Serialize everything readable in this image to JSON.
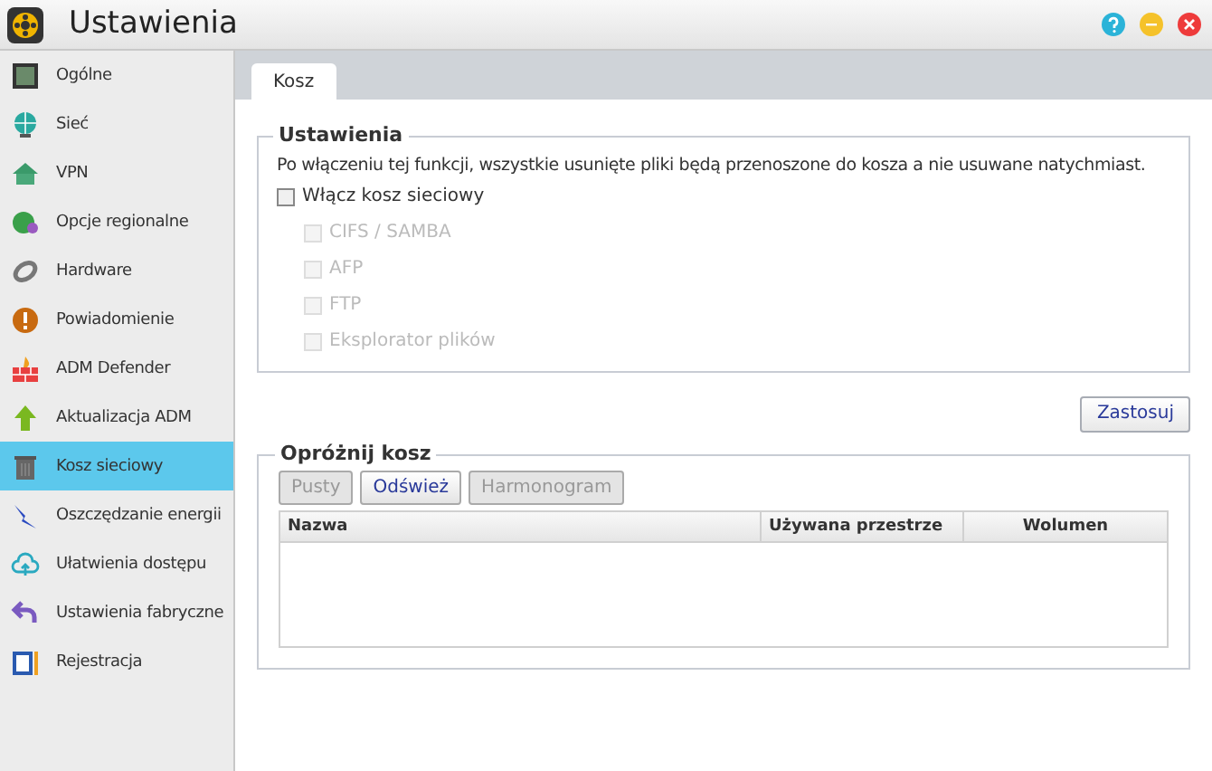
{
  "window": {
    "title": "Ustawienia"
  },
  "sidebar": {
    "items": [
      {
        "label": "Ogólne",
        "selected": false
      },
      {
        "label": "Sieć",
        "selected": false
      },
      {
        "label": "VPN",
        "selected": false
      },
      {
        "label": "Opcje regionalne",
        "selected": false
      },
      {
        "label": "Hardware",
        "selected": false
      },
      {
        "label": "Powiadomienie",
        "selected": false
      },
      {
        "label": "ADM Defender",
        "selected": false
      },
      {
        "label": "Aktualizacja ADM",
        "selected": false
      },
      {
        "label": "Kosz sieciowy",
        "selected": true
      },
      {
        "label": "Oszczędzanie energii",
        "selected": false
      },
      {
        "label": "Ułatwienia dostępu",
        "selected": false
      },
      {
        "label": "Ustawienia fabryczne",
        "selected": false
      },
      {
        "label": "Rejestracja",
        "selected": false
      }
    ]
  },
  "tabs": [
    {
      "label": "Kosz",
      "selected": true
    }
  ],
  "settings": {
    "title": "Ustawienia",
    "description": "Po włączeniu tej funkcji, wszystkie usunięte pliki będą przenoszone do kosza a nie usuwane natychmiast.",
    "enable": {
      "label": "Włącz kosz sieciowy",
      "checked": false
    },
    "options": [
      {
        "label": "CIFS / SAMBA",
        "checked": false,
        "disabled": true
      },
      {
        "label": "AFP",
        "checked": false,
        "disabled": true
      },
      {
        "label": "FTP",
        "checked": false,
        "disabled": true
      },
      {
        "label": "Eksplorator plików",
        "checked": false,
        "disabled": true
      }
    ]
  },
  "apply_button": "Zastosuj",
  "empty_trash": {
    "title": "Opróżnij kosz",
    "buttons": [
      {
        "label": "Pusty",
        "disabled": true
      },
      {
        "label": "Odśwież",
        "disabled": false
      },
      {
        "label": "Harmonogram",
        "disabled": true
      }
    ],
    "table": {
      "columns": [
        "Nazwa",
        "Używana przestrze",
        "Wolumen"
      ]
    }
  }
}
